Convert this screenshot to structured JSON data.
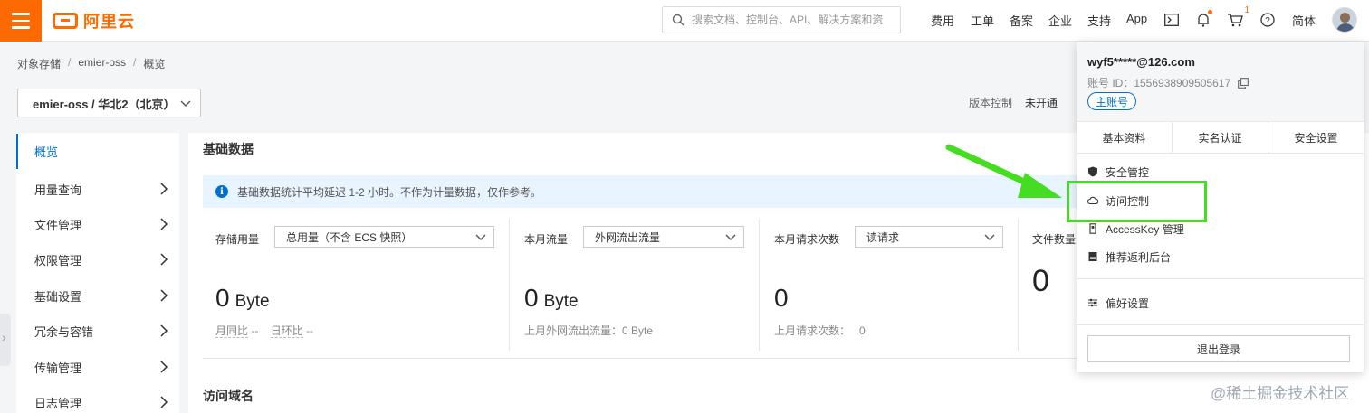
{
  "topbar": {
    "logo_text": "阿里云",
    "search_placeholder": "搜索文档、控制台、API、解决方案和资",
    "nav": [
      "费用",
      "工单",
      "备案",
      "企业",
      "支持",
      "App"
    ],
    "cart_count": "1",
    "language": "简体",
    "icons": [
      "terminal-icon",
      "bell-icon",
      "cart-icon",
      "help-icon"
    ]
  },
  "breadcrumb": [
    "对象存储",
    "emier-oss",
    "概览"
  ],
  "bucket_select": "emier-oss / 华北2（北京）",
  "version": {
    "label": "版本控制",
    "value": "未开通"
  },
  "sidebar": {
    "items": [
      {
        "label": "概览",
        "active": true
      },
      {
        "label": "用量查询"
      },
      {
        "label": "文件管理"
      },
      {
        "label": "权限管理"
      },
      {
        "label": "基础设置"
      },
      {
        "label": "冗余与容错"
      },
      {
        "label": "传输管理"
      },
      {
        "label": "日志管理"
      }
    ]
  },
  "main": {
    "basic_title": "基础数据",
    "notice": "基础数据统计平均延迟 1-2 小时。不作为计量数据，仅作参考。",
    "stats": [
      {
        "label": "存储用量",
        "select": "总用量（不含 ECS 快照）",
        "value": "0",
        "unit": "Byte",
        "sub_a": "月同比",
        "sub_a_val": "--",
        "sub_b": "日环比",
        "sub_b_val": "--"
      },
      {
        "label": "本月流量",
        "select": "外网流出流量",
        "value": "0",
        "unit": "Byte",
        "sub": "上月外网流出流量：0 Byte"
      },
      {
        "label": "本月请求次数",
        "select": "读请求",
        "value": "0",
        "unit": "",
        "sub": "上月请求次数：   0"
      },
      {
        "label": "文件数量",
        "value": "0"
      }
    ],
    "domain_title": "访问域名"
  },
  "dropdown": {
    "email": "wyf5*****@126.com",
    "account_id": "账号 ID：1556938909505617",
    "tag": "主账号",
    "tabs": [
      "基本资料",
      "实名认证",
      "安全设置"
    ],
    "items": [
      {
        "label": "安全管控",
        "icon": "shield-icon"
      },
      {
        "label": "访问控制",
        "icon": "cloud-icon"
      },
      {
        "label": "AccessKey 管理",
        "icon": "key-icon"
      },
      {
        "label": "推荐返利后台",
        "icon": "gift-icon"
      }
    ],
    "pref": "偏好设置",
    "logout": "退出登录"
  },
  "watermark": "@稀土掘金技术社区",
  "colors": {
    "brand": "#ff6a00",
    "accent": "#0070cc",
    "annotation": "#44dd22"
  }
}
